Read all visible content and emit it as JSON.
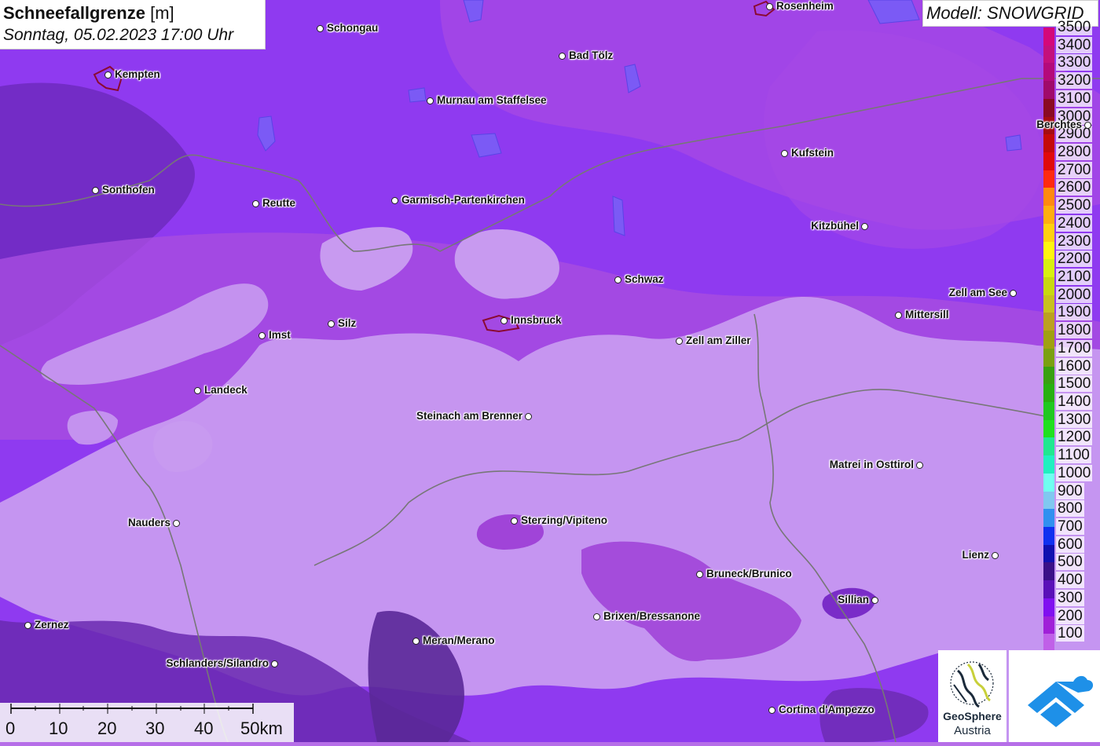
{
  "title": {
    "main": "Schneefallgrenze",
    "unit": "[m]",
    "datetime": "Sonntag, 05.02.2023 17:00 Uhr"
  },
  "model": "Modell: SNOWGRID",
  "legend": [
    {
      "value": "3500",
      "color": "#d4087a"
    },
    {
      "value": "3400",
      "color": "#c4107c"
    },
    {
      "value": "3300",
      "color": "#b40a7a"
    },
    {
      "value": "3200",
      "color": "#a00a6a"
    },
    {
      "value": "3100",
      "color": "#8a0a22"
    },
    {
      "value": "3000",
      "color": "#a50c12"
    },
    {
      "value": "2900",
      "color": "#c40a0a"
    },
    {
      "value": "2800",
      "color": "#e00a0a"
    },
    {
      "value": "2700",
      "color": "#ff2a10"
    },
    {
      "value": "2600",
      "color": "#ff8a10"
    },
    {
      "value": "2500",
      "color": "#ffae10"
    },
    {
      "value": "2400",
      "color": "#ffd010"
    },
    {
      "value": "2300",
      "color": "#fff510"
    },
    {
      "value": "2200",
      "color": "#d8f010"
    },
    {
      "value": "2100",
      "color": "#c8d810"
    },
    {
      "value": "2000",
      "color": "#c8c020"
    },
    {
      "value": "1900",
      "color": "#bca020"
    },
    {
      "value": "1800",
      "color": "#a0a010"
    },
    {
      "value": "1700",
      "color": "#7aa010"
    },
    {
      "value": "1600",
      "color": "#38a010"
    },
    {
      "value": "1500",
      "color": "#28b010"
    },
    {
      "value": "1400",
      "color": "#20c820"
    },
    {
      "value": "1300",
      "color": "#20e020"
    },
    {
      "value": "1200",
      "color": "#20e890"
    },
    {
      "value": "1100",
      "color": "#20f0c0"
    },
    {
      "value": "1000",
      "color": "#70fff0"
    },
    {
      "value": "900",
      "color": "#80c8f0"
    },
    {
      "value": "800",
      "color": "#3090f0"
    },
    {
      "value": "700",
      "color": "#1030f0"
    },
    {
      "value": "600",
      "color": "#1010b0"
    },
    {
      "value": "500",
      "color": "#3a1088"
    },
    {
      "value": "400",
      "color": "#5a10b8"
    },
    {
      "value": "300",
      "color": "#8010f0"
    },
    {
      "value": "200",
      "color": "#a020d8"
    },
    {
      "value": "100",
      "color": "#c060e8"
    }
  ],
  "cities": [
    {
      "name": "Rosenheim",
      "label_side": "right"
    },
    {
      "name": "Schongau",
      "label_side": "right"
    },
    {
      "name": "Bad Tölz",
      "label_side": "right"
    },
    {
      "name": "Kempten",
      "label_side": "right"
    },
    {
      "name": "Murnau am Staffelsee",
      "label_side": "right"
    },
    {
      "name": "Berchtes",
      "label_side": "left"
    },
    {
      "name": "Kufstein",
      "label_side": "right"
    },
    {
      "name": "Sonthofen",
      "label_side": "right"
    },
    {
      "name": "Reutte",
      "label_side": "right"
    },
    {
      "name": "Garmisch-Partenkirchen",
      "label_side": "right"
    },
    {
      "name": "Kitzbühel",
      "label_side": "left"
    },
    {
      "name": "Schwaz",
      "label_side": "right"
    },
    {
      "name": "Zell am See",
      "label_side": "left"
    },
    {
      "name": "Mittersill",
      "label_side": "right"
    },
    {
      "name": "Silz",
      "label_side": "right"
    },
    {
      "name": "Innsbruck",
      "label_side": "right"
    },
    {
      "name": "Imst",
      "label_side": "right"
    },
    {
      "name": "Zell am Ziller",
      "label_side": "right"
    },
    {
      "name": "Landeck",
      "label_side": "right"
    },
    {
      "name": "Steinach am Brenner",
      "label_side": "left"
    },
    {
      "name": "Matrei in Osttirol",
      "label_side": "left"
    },
    {
      "name": "Nauders",
      "label_side": "left"
    },
    {
      "name": "Sterzing/Vipiteno",
      "label_side": "right"
    },
    {
      "name": "Lienz",
      "label_side": "left"
    },
    {
      "name": "Bruneck/Brunico",
      "label_side": "right"
    },
    {
      "name": "Sillian",
      "label_side": "left"
    },
    {
      "name": "Brixen/Bressanone",
      "label_side": "right"
    },
    {
      "name": "Zernez",
      "label_side": "right"
    },
    {
      "name": "Meran/Merano",
      "label_side": "right"
    },
    {
      "name": "Schlanders/Silandro",
      "label_side": "left"
    },
    {
      "name": "Cortina d'Ampezzo",
      "label_side": "right"
    }
  ],
  "scale": {
    "ticks": [
      "0",
      "10",
      "20",
      "30",
      "40",
      "50km"
    ]
  },
  "logos": {
    "geosphere_line1": "GeoSphere",
    "geosphere_line2": "Austria"
  }
}
